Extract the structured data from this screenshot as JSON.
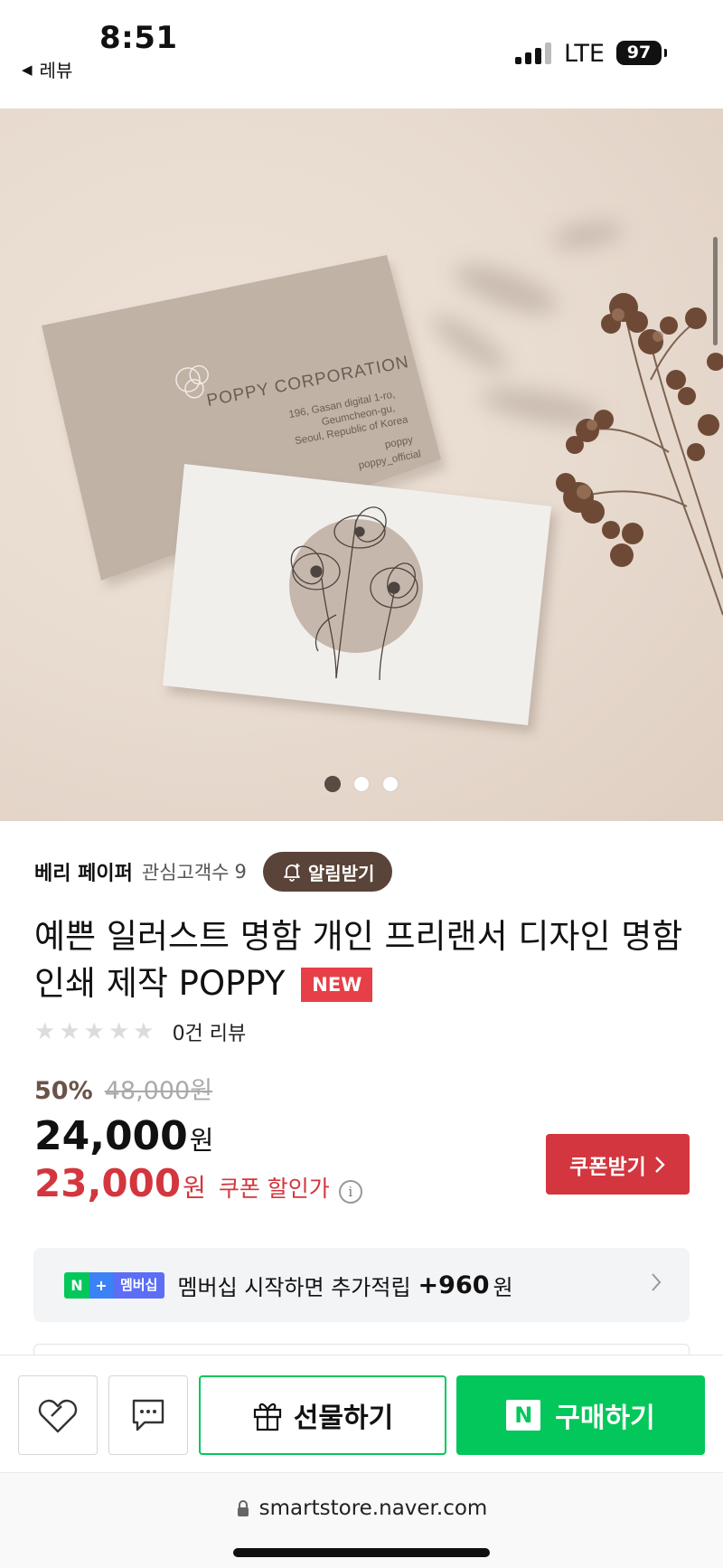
{
  "status_bar": {
    "time": "8:51",
    "back_label": "레뷰",
    "network": "LTE",
    "battery": "97"
  },
  "hero": {
    "card_title": "POPPY CORPORATION",
    "card_address_1": "196, Gasan digital 1-ro,",
    "card_address_2": "Geumcheon-gu,",
    "card_address_3": "Seoul, Republic of Korea",
    "card_handle_1": "poppy",
    "card_handle_2": "poppy_official",
    "carousel_count": 3,
    "carousel_active": 1
  },
  "seller": {
    "name": "베리 페이퍼",
    "fans_label": "관심고객수",
    "fans_count": "9",
    "alarm_label": "알림받기"
  },
  "product": {
    "title": "예쁜 일러스트 명함 개인 프리랜서 디자인 명함 인쇄 제작 POPPY",
    "badge": "NEW",
    "rating_stars": 0,
    "review_text": "0건 리뷰"
  },
  "price": {
    "discount": "50%",
    "original": "48,000원",
    "sale": "24,000",
    "sale_unit": "원",
    "coupon_price": "23,000",
    "coupon_unit": "원",
    "coupon_label": "쿠폰 할인가",
    "coupon_button": "쿠폰받기"
  },
  "membership": {
    "logo_n": "N",
    "logo_plus": "+",
    "logo_text": "멤버십",
    "text": "멤버십 시작하면 추가적립",
    "points": "+960",
    "unit": "원"
  },
  "bottom_bar": {
    "gift_label": "선물하기",
    "buy_label": "구매하기",
    "buy_logo": "N"
  },
  "browser": {
    "url": "smartstore.naver.com"
  },
  "colors": {
    "naver_green": "#03c75a",
    "coupon_red": "#d3363e",
    "alarm_brown": "#5a4338",
    "badge_red": "#e73f48"
  }
}
